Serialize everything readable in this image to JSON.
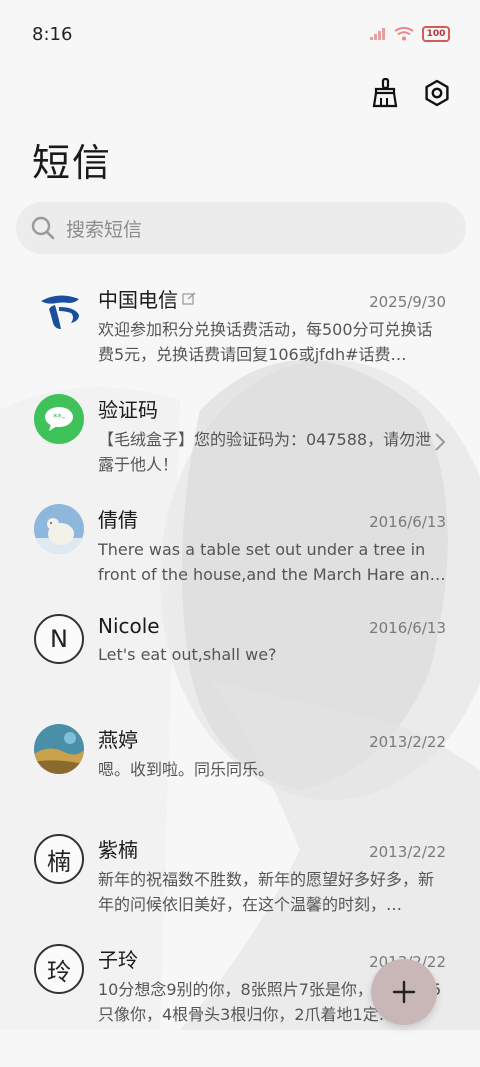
{
  "status_bar": {
    "time": "8:16",
    "battery": "100"
  },
  "header": {
    "title": "短信",
    "clean_icon": "broom-icon",
    "settings_icon": "gear-icon"
  },
  "search": {
    "placeholder": "搜索短信"
  },
  "conversations": [
    {
      "name": "中国电信",
      "date": "2025/9/30",
      "preview": "欢迎参加积分兑换话费活动，每500分可兑换话费5元，兑换话费请回复106或jfdh#话费…",
      "avatar": "china-telecom-logo",
      "has_edit_badge": true
    },
    {
      "name": "验证码",
      "date": "",
      "preview": "【毛绒盒子】您的验证码为：047588，请勿泄露于他人！",
      "avatar": "message-bubble-icon"
    },
    {
      "name": "倩倩",
      "date": "2016/6/13",
      "preview": "There was a table set out under a tree in front of the house,and the March Hare an…",
      "avatar": "polar-bear-photo"
    },
    {
      "name": "Nicole",
      "date": "2016/6/13",
      "preview": "Let's eat out,shall we?",
      "avatar_letter": "N"
    },
    {
      "name": "燕婷",
      "date": "2013/2/22",
      "preview": "嗯。收到啦。同乐同乐。",
      "avatar": "landscape-photo"
    },
    {
      "name": "紫楠",
      "date": "2013/2/22",
      "preview": "新年的祝福数不胜数，新年的愿望好多好多，新年的问候依旧美好，在这个温馨的时刻，…",
      "avatar_letter": "楠"
    },
    {
      "name": "子玲",
      "date": "2013/2/22",
      "preview": "10分想念9别的你，8张照片7张是你，6只小狗5只像你，4根骨头3根归你，2爪着地1定…",
      "avatar_letter": "玲"
    }
  ],
  "fab": {
    "icon": "plus-icon"
  },
  "colors": {
    "telecom_blue": "#1a4fa0",
    "wechat_green": "#3fc25a",
    "fab_bg": "#c9b7b7",
    "status_red": "#d65a5a"
  }
}
